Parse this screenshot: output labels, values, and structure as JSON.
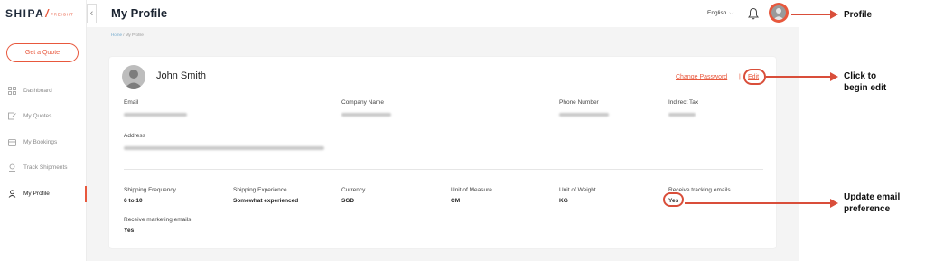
{
  "brand": {
    "name": "SHIPA",
    "slash": "/",
    "sub": "FREIGHT"
  },
  "sidebar": {
    "collapse_icon": "‹",
    "quote_button": "Get a Quote",
    "items": [
      {
        "label": "Dashboard",
        "icon": "dashboard-icon"
      },
      {
        "label": "My Quotes",
        "icon": "quotes-icon"
      },
      {
        "label": "My Bookings",
        "icon": "bookings-icon"
      },
      {
        "label": "Track Shipments",
        "icon": "track-icon"
      },
      {
        "label": "My Profile",
        "icon": "profile-icon",
        "active": true
      }
    ]
  },
  "header": {
    "title": "My Profile",
    "language": "English",
    "language_chevron": "⌵"
  },
  "breadcrumb": {
    "home": "Home",
    "sep": "/",
    "current": "My Profile"
  },
  "profile": {
    "name": "John Smith",
    "change_password": "Change Password",
    "separator": "|",
    "edit": "Edit",
    "fields": {
      "email": "Email",
      "company": "Company Name",
      "phone": "Phone Number",
      "tax": "Indirect Tax",
      "address": "Address"
    },
    "prefs": [
      {
        "label": "Shipping Frequency",
        "value": "6 to 10"
      },
      {
        "label": "Shipping Experience",
        "value": "Somewhat experienced"
      },
      {
        "label": "Currency",
        "value": "SGD"
      },
      {
        "label": "Unit of Measure",
        "value": "CM"
      },
      {
        "label": "Unit of Weight",
        "value": "KG"
      },
      {
        "label": "Receive tracking emails",
        "value": "Yes"
      }
    ],
    "marketing": {
      "label": "Receive marketing emails",
      "value": "Yes"
    }
  },
  "annotations": {
    "profile": "Profile",
    "edit_line1": "Click to",
    "edit_line2": "begin edit",
    "email_line1": "Update email",
    "email_line2": "preference"
  },
  "colors": {
    "accent": "#e8583d",
    "annotation": "#d94e3a",
    "page_bg": "#f4f4f4"
  }
}
